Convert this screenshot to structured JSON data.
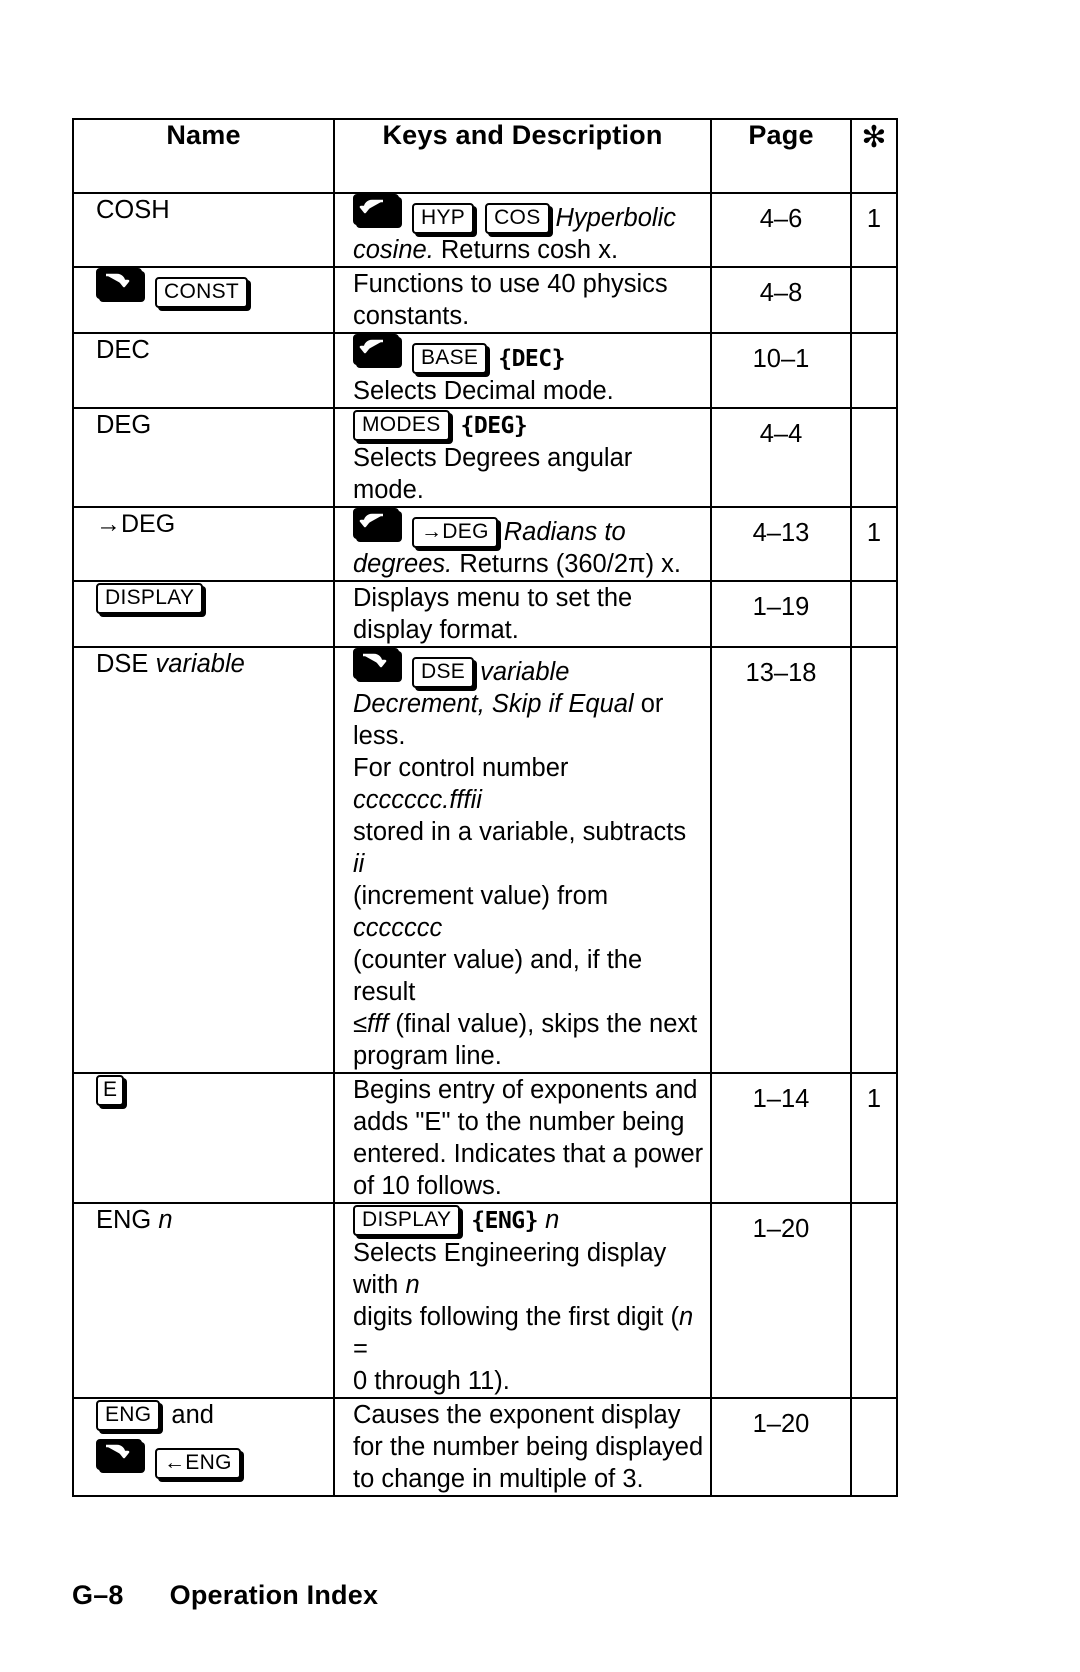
{
  "document": {
    "footer": {
      "page_number": "G–8",
      "section_title": "Operation Index"
    }
  },
  "table": {
    "headers": {
      "name": "Name",
      "keys_description": "Keys and Description",
      "page": "Page",
      "footnote": "✻"
    },
    "rows": [
      {
        "id": "cosh",
        "name_text": "COSH",
        "name_keys": [],
        "keys": [
          {
            "type": "shift-left",
            "label": "left-shift"
          },
          {
            "type": "key",
            "label": "HYP"
          },
          {
            "type": "key",
            "label": "COS"
          }
        ],
        "desc_italic_lead": "Hyperbolic cosine.",
        "desc_rest": " Returns cosh x.",
        "page": "4–6",
        "footnote": "1"
      },
      {
        "id": "const",
        "name_text": "",
        "name_keys": [
          {
            "type": "shift-right",
            "label": "right-shift"
          },
          {
            "type": "key",
            "label": "CONST"
          }
        ],
        "keys": [],
        "desc_italic_lead": "",
        "desc_rest": "Functions to use 40 physics constants.",
        "page": "4–8",
        "footnote": ""
      },
      {
        "id": "dec",
        "name_text": "DEC",
        "name_keys": [],
        "keys": [
          {
            "type": "shift-left",
            "label": "left-shift"
          },
          {
            "type": "key",
            "label": "BASE"
          }
        ],
        "menu": "{DEC}",
        "desc_italic_lead": "",
        "desc_rest": "Selects Decimal mode.",
        "page": "10–1",
        "footnote": ""
      },
      {
        "id": "deg",
        "name_text": "DEG",
        "name_keys": [],
        "keys": [
          {
            "type": "key",
            "label": "MODES"
          }
        ],
        "menu": "{DEG}",
        "desc_italic_lead": "",
        "desc_rest": "Selects Degrees angular mode.",
        "page": "4–4",
        "footnote": ""
      },
      {
        "id": "to-deg",
        "name_text": "→DEG",
        "name_keys": [],
        "keys": [
          {
            "type": "shift-left",
            "label": "left-shift"
          },
          {
            "type": "key",
            "label": "→DEG"
          }
        ],
        "desc_italic_lead": "Radians to degrees.",
        "desc_rest": " Returns (360/2π) x.",
        "page": "4–13",
        "footnote": "1"
      },
      {
        "id": "display",
        "name_text": "",
        "name_keys": [
          {
            "type": "key",
            "label": "DISPLAY"
          }
        ],
        "keys": [],
        "desc_italic_lead": "",
        "desc_rest": "Displays menu to set the display format.",
        "page": "1–19",
        "footnote": ""
      },
      {
        "id": "dse-variable",
        "name_text": "DSE ",
        "name_italic": "variable",
        "name_keys": [],
        "keys": [
          {
            "type": "shift-right",
            "label": "right-shift"
          },
          {
            "type": "key",
            "label": "DSE"
          }
        ],
        "desc_italic_lead": "variable",
        "desc_rest": "",
        "page": "13–18",
        "footnote": ""
      },
      {
        "id": "exponent-e",
        "name_text": "",
        "name_keys": [
          {
            "type": "key-narrow",
            "label": "E"
          }
        ],
        "keys": [],
        "desc_italic_lead": "",
        "desc_rest": "Begins entry of exponents and adds \"E\" to the number being entered. Indicates that a power of 10 follows.",
        "page": "1–14",
        "footnote": "1"
      },
      {
        "id": "eng-n",
        "name_text": "ENG ",
        "name_italic": "n",
        "name_keys": [],
        "keys": [
          {
            "type": "key",
            "label": "DISPLAY"
          }
        ],
        "menu": "{ENG}",
        "desc_italic_lead": "",
        "desc_rest": "",
        "page": "1–20",
        "footnote": ""
      },
      {
        "id": "eng-shift",
        "name_text": "",
        "name_keys": [
          {
            "type": "key",
            "label": "ENG"
          }
        ],
        "name_after": "and",
        "name_keys2": [
          {
            "type": "shift-right",
            "label": "right-shift"
          },
          {
            "type": "key",
            "label": "←ENG"
          }
        ],
        "keys": [],
        "desc_italic_lead": "",
        "desc_rest": "Causes the exponent display for the number being displayed to change in multiple of 3.",
        "page": "1–20",
        "footnote": ""
      }
    ],
    "dse_description": {
      "line1_italic": "Decrement, Skip if Equal",
      "line1_rest": " or less.",
      "line2_pre": "For control number ",
      "line2_italic": "ccccccc.fffii",
      "line3_pre": "stored in a variable, subtracts ",
      "line3_italic": "ii",
      "line4_pre": "(increment value) from ",
      "line4_italic": "ccccccc",
      "line5": "(counter value) and, if the result",
      "line6_pre": "≤",
      "line6_italic": "fff",
      "line6_rest": " (final value), skips the next",
      "line7": "program line."
    },
    "eng_description": {
      "line1_pre": "Selects Engineering display with ",
      "line1_italic": "n",
      "line2_pre": "digits following the first digit (",
      "line2_italic": "n",
      "line2_rest": " =",
      "line3": "0 through 11)."
    }
  }
}
